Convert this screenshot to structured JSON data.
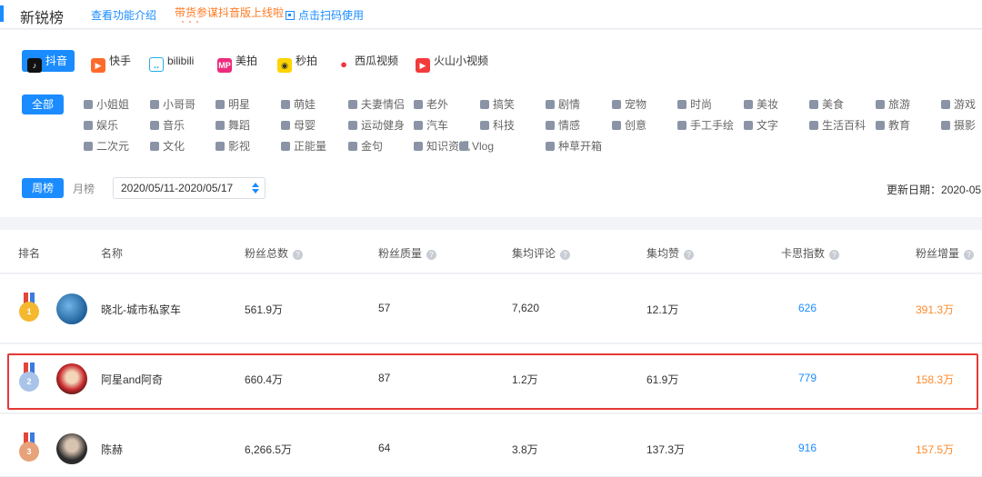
{
  "header": {
    "title": "新锐榜",
    "link_intro": "查看功能介绍",
    "link_promo": "带货参谋抖音版上线啦",
    "link_qr": "点击扫码使用"
  },
  "platforms": [
    {
      "label": "抖音",
      "icon": "douyin-icon",
      "active": true
    },
    {
      "label": "快手",
      "icon": "kuaishou-icon",
      "active": false
    },
    {
      "label": "bilibili",
      "icon": "bilibili-icon",
      "active": false
    },
    {
      "label": "美拍",
      "icon": "meipai-icon",
      "active": false
    },
    {
      "label": "秒拍",
      "icon": "miaopai-icon",
      "active": false
    },
    {
      "label": "西瓜视频",
      "icon": "xigua-icon",
      "active": false
    },
    {
      "label": "火山小视频",
      "icon": "huoshan-icon",
      "active": false
    }
  ],
  "categories": {
    "all_label": "全部",
    "items": [
      "小姐姐",
      "小哥哥",
      "明星",
      "萌娃",
      "夫妻情侣",
      "老外",
      "搞笑",
      "剧情",
      "宠物",
      "时尚",
      "美妆",
      "美食",
      "旅游",
      "游戏",
      "娱乐",
      "音乐",
      "舞蹈",
      "母婴",
      "运动健身",
      "汽车",
      "科技",
      "情感",
      "创意",
      "手工手绘",
      "文字",
      "生活百科",
      "教育",
      "摄影",
      "二次元",
      "文化",
      "影视",
      "正能量",
      "金句",
      "知识资讯",
      "Vlog",
      "种草开箱"
    ]
  },
  "period": {
    "week_label": "周榜",
    "month_label": "月榜",
    "date_range": "2020/05/11-2020/05/17",
    "update_label": "更新日期：",
    "update_value": "2020-05"
  },
  "table": {
    "headers": [
      "排名",
      "名称",
      "粉丝总数",
      "粉丝质量",
      "集均评论",
      "集均赞",
      "卡思指数",
      "粉丝增量"
    ],
    "rows": [
      {
        "rank": "1",
        "name": "晓北-城市私家车",
        "fans": "561.9万",
        "quality": "57",
        "comments": "7,620",
        "likes": "12.1万",
        "index": "626",
        "growth": "391.3万"
      },
      {
        "rank": "2",
        "name": "阿星and阿奇",
        "fans": "660.4万",
        "quality": "87",
        "comments": "1.2万",
        "likes": "61.9万",
        "index": "779",
        "growth": "158.3万"
      },
      {
        "rank": "3",
        "name": "陈赫",
        "fans": "6,266.5万",
        "quality": "64",
        "comments": "3.8万",
        "likes": "137.3万",
        "index": "916",
        "growth": "157.5万"
      }
    ]
  },
  "colors": {
    "accent": "#1a8cff",
    "orange": "#ff8a2a",
    "highlight": "#e53935",
    "gold": "#f5b82e",
    "silver": "#a9c4e8",
    "bronze": "#e8a27a"
  }
}
